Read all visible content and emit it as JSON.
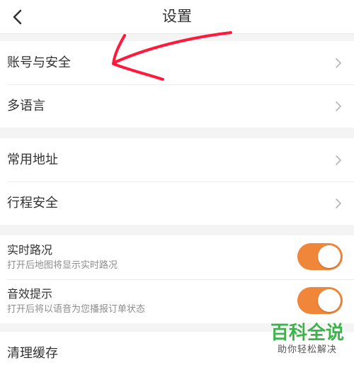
{
  "header": {
    "title": "设置",
    "back_icon": "chevron-left-icon"
  },
  "group1": {
    "items": [
      {
        "label": "账号与安全"
      },
      {
        "label": "多语言"
      }
    ]
  },
  "group2": {
    "items": [
      {
        "label": "常用地址"
      },
      {
        "label": "行程安全"
      }
    ]
  },
  "toggles": [
    {
      "title": "实时路况",
      "subtitle": "打开后地图将显示实时路况",
      "on": true
    },
    {
      "title": "音效提示",
      "subtitle": "打开后将以语音为您播报订单状态",
      "on": true
    }
  ],
  "group4": {
    "items": [
      {
        "label": "清理缓存"
      }
    ]
  },
  "watermark": {
    "title": "百科全说",
    "subtitle": "助你轻松解决"
  },
  "colors": {
    "accent": "#f0863a",
    "annotation": "#ff1a3c",
    "watermark": "#3bb54a"
  }
}
